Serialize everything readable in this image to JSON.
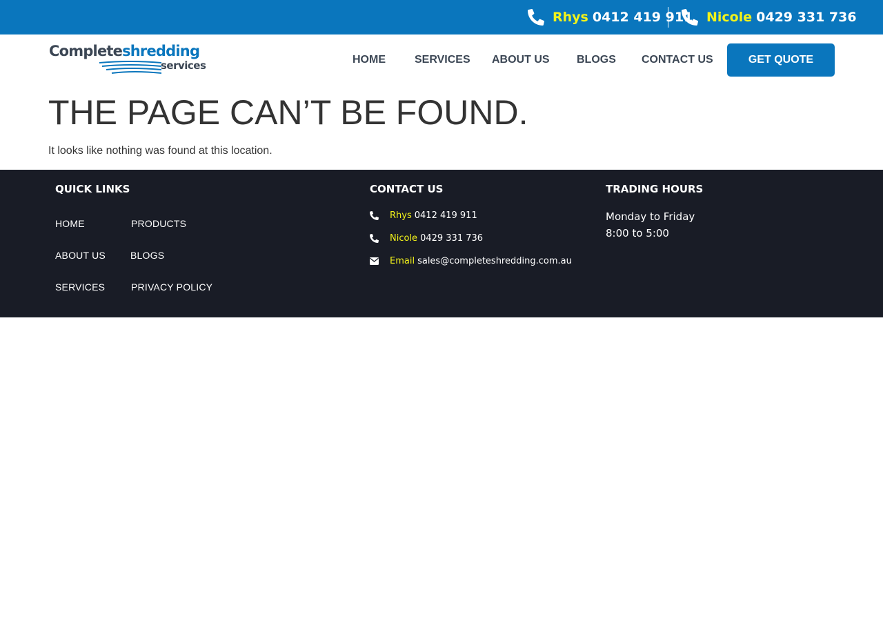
{
  "topbar": {
    "phones": [
      {
        "name": "Rhys",
        "number": "0412 419 911"
      },
      {
        "name": "Nicole",
        "number": "0429 331 736"
      }
    ]
  },
  "logo": {
    "word1": "Complete",
    "word2": "shredding",
    "word3": "services"
  },
  "nav": {
    "items": [
      "HOME",
      "SERVICES",
      "ABOUT US",
      "BLOGS",
      "CONTACT US"
    ],
    "cta": "GET QUOTE"
  },
  "main": {
    "title": "THE PAGE CAN’T BE FOUND.",
    "text": "It looks like nothing was found at this location."
  },
  "footer": {
    "quick_links": {
      "heading": "QUICK LINKS",
      "col1": [
        "HOME",
        "ABOUT US",
        "SERVICES"
      ],
      "col2": [
        "PRODUCTS",
        "BLOGS",
        "PRIVACY POLICY"
      ]
    },
    "contact": {
      "heading": "CONTACT US",
      "rows": [
        {
          "icon": "phone-icon",
          "label": "Rhys",
          "value": "0412 419 911"
        },
        {
          "icon": "phone-icon",
          "label": "Nicole",
          "value": "0429 331 736"
        },
        {
          "icon": "envelope-icon",
          "label": "Email",
          "value": "sales@completeshredding.com.au"
        }
      ]
    },
    "hours": {
      "heading": "TRADING HOURS",
      "line1": "Monday to Friday",
      "line2": "8:00 to 5:00"
    }
  },
  "colors": {
    "brand_blue": "#0a76bd",
    "accent_yellow": "#f2f21a",
    "footer_bg": "#191c26",
    "nav_text": "#3b4654"
  }
}
